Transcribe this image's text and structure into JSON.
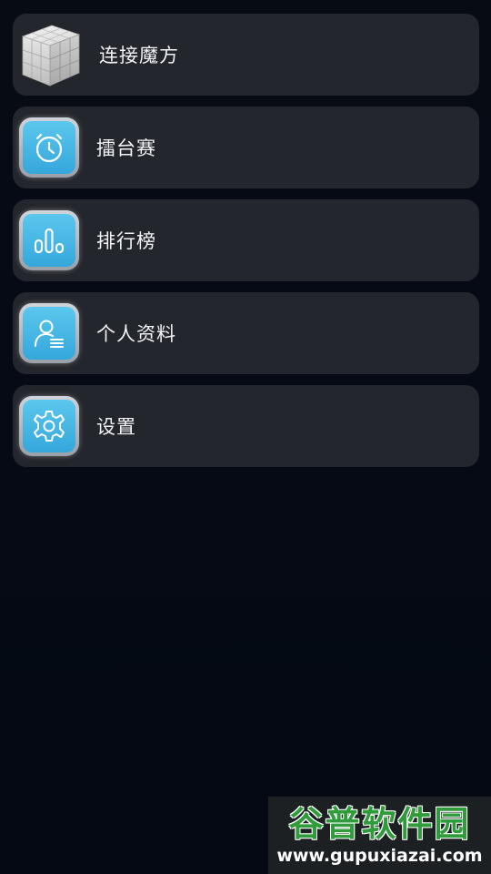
{
  "menu": {
    "items": [
      {
        "label": "连接魔方",
        "icon": "rubiks-cube-icon"
      },
      {
        "label": "擂台赛",
        "icon": "stopwatch-icon"
      },
      {
        "label": "排行榜",
        "icon": "bar-chart-icon"
      },
      {
        "label": "个人资料",
        "icon": "user-profile-icon"
      },
      {
        "label": "设置",
        "icon": "gear-icon"
      }
    ]
  },
  "watermark": {
    "brand": "谷普软件园",
    "url": "www.gupuxiazai.com"
  },
  "colors": {
    "background": "#050a13",
    "card": "#24262d",
    "icon_accent": "#4bbbe8",
    "watermark_green": "#2f9b3a"
  }
}
